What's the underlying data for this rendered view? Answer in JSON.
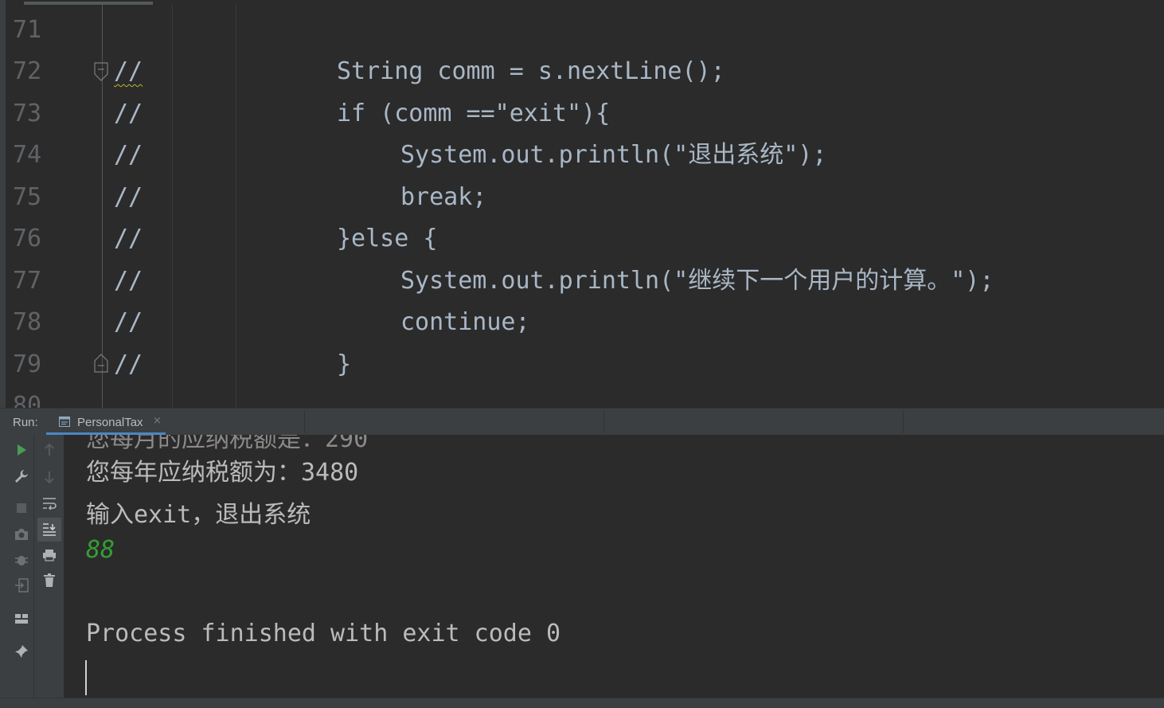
{
  "editor": {
    "lines": [
      {
        "num": "71",
        "comment": "",
        "code": ""
      },
      {
        "num": "72",
        "comment": "//",
        "code": "String comm = s.nextLine();"
      },
      {
        "num": "73",
        "comment": "//",
        "code": "if (comm ==\"exit\"){"
      },
      {
        "num": "74",
        "comment": "//",
        "code": "System.out.println(\"退出系统\");"
      },
      {
        "num": "75",
        "comment": "//",
        "code": "break;"
      },
      {
        "num": "76",
        "comment": "//",
        "code": "}else {"
      },
      {
        "num": "77",
        "comment": "//",
        "code": "System.out.println(\"继续下一个用户的计算。\");"
      },
      {
        "num": "78",
        "comment": "//",
        "code": "continue;"
      },
      {
        "num": "79",
        "comment": "//",
        "code": "}"
      },
      {
        "num": "80",
        "comment": "",
        "code": ""
      }
    ]
  },
  "run": {
    "label": "Run:",
    "tab_title": "PersonalTax",
    "tab_close": "×"
  },
  "console": {
    "lines": [
      "您每年应纳税额为：3480",
      "输入exit，退出系统",
      "88",
      "Process finished with exit code 0"
    ]
  },
  "colors": {
    "background": "#2b2b2b",
    "toolbar": "#3c3f41",
    "code_text": "#a9b7c6",
    "line_number": "#606366",
    "user_input": "#349e34",
    "tab_underline": "#4a88c7"
  },
  "icons": {
    "toolbar_left": [
      "rerun-icon",
      "wrench-icon",
      "stop-icon",
      "camera-icon",
      "debug-icon",
      "exit-icon",
      "layout-icon",
      "pin-icon"
    ],
    "toolbar_right": [
      "up-arrow-icon",
      "down-arrow-icon",
      "soft-wrap-icon",
      "scroll-to-end-icon",
      "print-icon",
      "trash-icon"
    ]
  }
}
